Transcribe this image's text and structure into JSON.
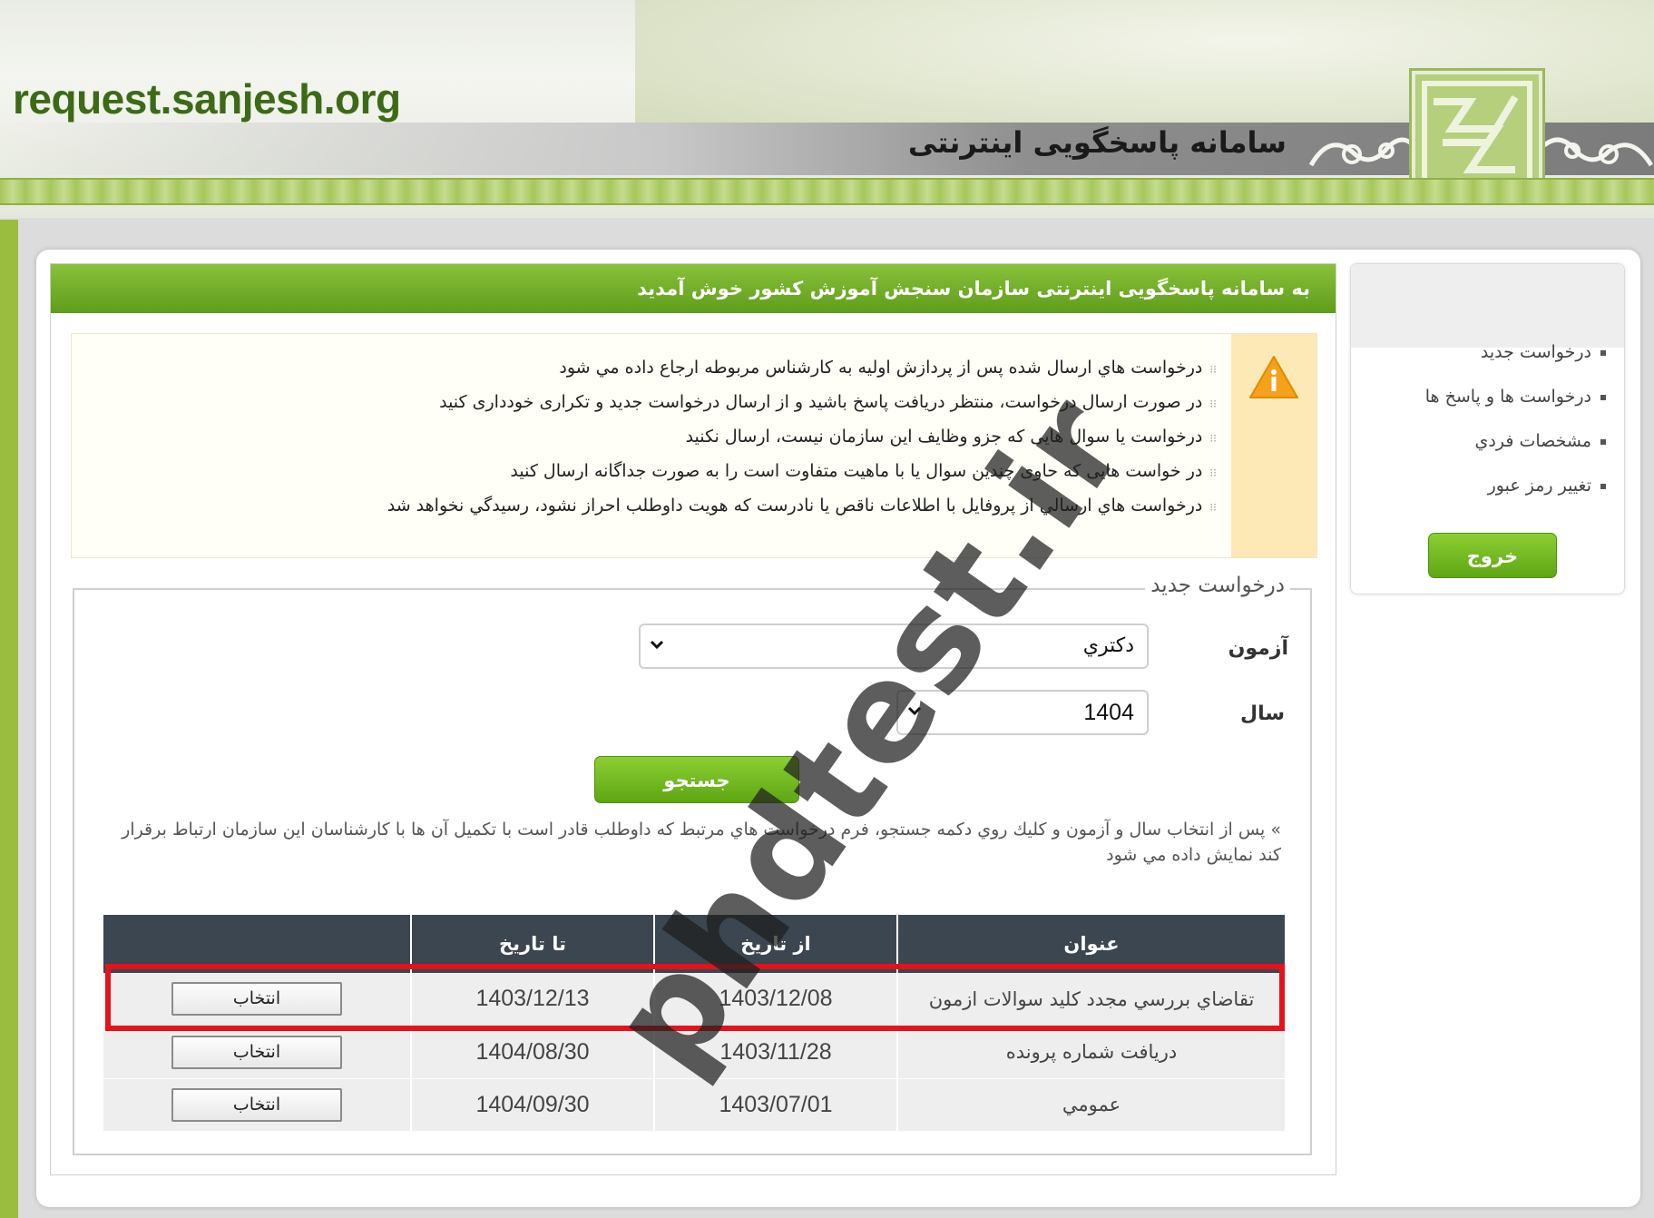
{
  "header": {
    "site_url": "request.sanjesh.org",
    "system_title": "سامانه پاسخگویی اینترنتی"
  },
  "welcome": "به سامانه پاسخگویی اینترنتی سازمان سنجش آموزش کشور خوش آمدید",
  "notices": [
    "درخواست هاي ارسال شده پس از پردازش اوليه به كارشناس مربوطه ارجاع داده مي شود",
    "در صورت ارسال درخواست، منتظر دریافت پاسخ باشید و از ارسال درخواست جدید و تکراری خودداری کنید",
    "درخواست یا سوال هایی که جزو وظایف این سازمان نیست، ارسال نکنید",
    "در خواست هایی که حاوی چندین سوال یا با ماهیت متفاوت است را به صورت جداگانه ارسال کنید",
    "درخواست هاي ارسالي از پروفايل با اطلاعات ناقص يا نادرست كه هويت داوطلب احراز نشود، رسيدگي نخواهد شد"
  ],
  "sidebar": {
    "items": [
      {
        "label": "درخواست جديد"
      },
      {
        "label": "درخواست ها و پاسخ ها"
      },
      {
        "label": "مشخصات فردي"
      },
      {
        "label": "تغيير رمز عبور"
      }
    ],
    "exit_label": "خروج"
  },
  "form": {
    "legend": "درخواست جديد",
    "exam_label": "آزمون",
    "exam_value": "دكتري",
    "year_label": "سال",
    "year_value": "1404",
    "search_label": "جستجو",
    "help": "» پس از انتخاب سال و آزمون و كليك روي دكمه جستجو، فرم درخواست هاي مرتبط كه داوطلب قادر است با تكميل آن ها با كارشناسان اين سازمان ارتباط برقرار كند نمايش داده مي شود"
  },
  "table": {
    "headers": [
      "عنوان",
      "از تاريخ",
      "تا تاريخ",
      ""
    ],
    "rows": [
      {
        "title": "تقاضاي بررسي مجدد كليد سوالات ازمون",
        "from": "1403/12/08",
        "to": "1403/12/13",
        "action": "انتخاب"
      },
      {
        "title": "دريافت شماره پرونده",
        "from": "1403/11/28",
        "to": "1404/08/30",
        "action": "انتخاب"
      },
      {
        "title": "عمومي",
        "from": "1403/07/01",
        "to": "1404/09/30",
        "action": "انتخاب"
      }
    ]
  },
  "watermark": "phdtest.ir",
  "colors": {
    "accent_green": "#5ea614",
    "header_green": "#9bbd3f",
    "table_header": "#3c4650",
    "highlight_red": "#e5121c",
    "warning_bg": "#fde9b6"
  },
  "icons": [
    "warning-icon",
    "chevron-down-icon",
    "logo-emblem"
  ]
}
